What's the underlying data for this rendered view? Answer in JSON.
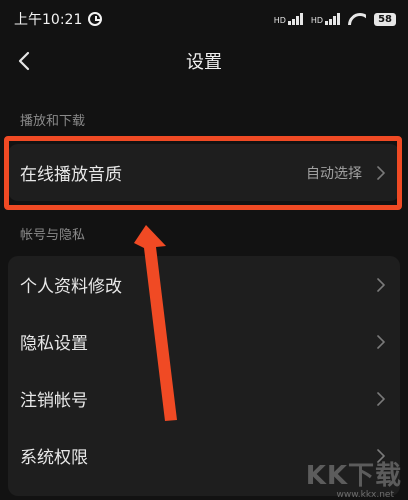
{
  "status_bar": {
    "time": "上午10:21",
    "signal_tag_1": "HD",
    "signal_tag_2": "HD",
    "battery": "58"
  },
  "header": {
    "title": "设置"
  },
  "sections": [
    {
      "label": "播放和下载",
      "items": [
        {
          "label": "在线播放音质",
          "value": "自动选择"
        }
      ]
    },
    {
      "label": "帐号与隐私",
      "items": [
        {
          "label": "个人资料修改"
        },
        {
          "label": "隐私设置"
        },
        {
          "label": "注销帐号"
        },
        {
          "label": "系统权限"
        }
      ]
    }
  ],
  "annotation": {
    "highlight_color": "#f04a24"
  },
  "watermark": {
    "text": "KK下载",
    "url": "www.kkx.net"
  }
}
